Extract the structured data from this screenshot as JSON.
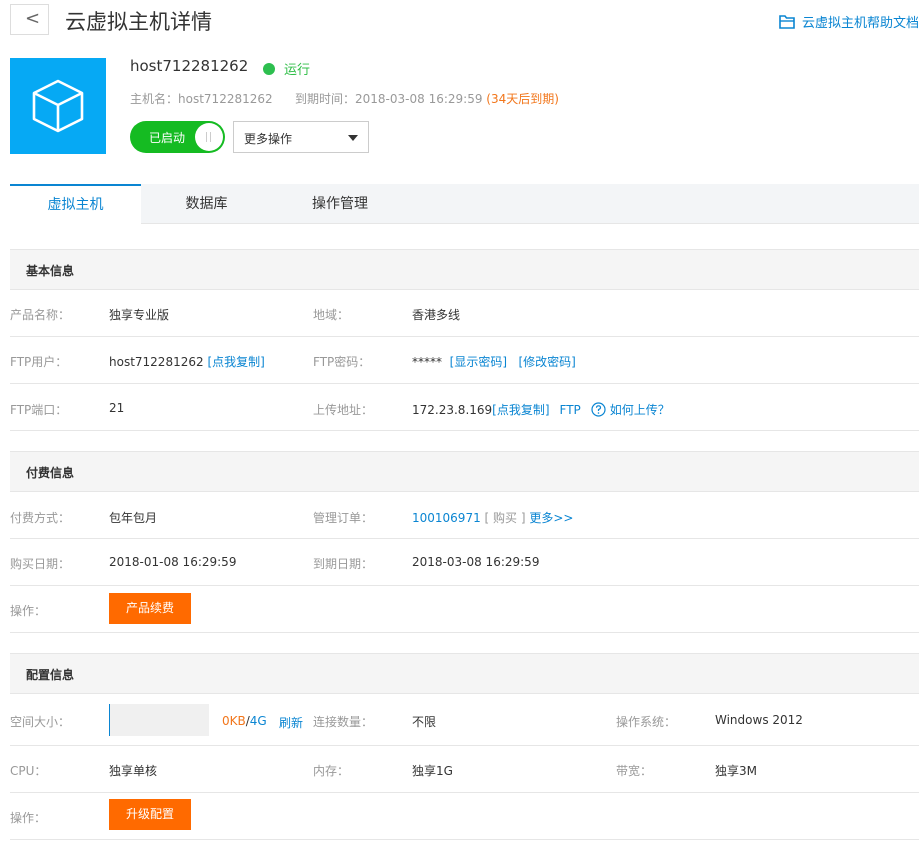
{
  "header": {
    "back_label": "<",
    "title": "云虚拟主机详情",
    "help_label": "云虚拟主机帮助文档"
  },
  "host": {
    "name": "host712281262",
    "status": "运行",
    "hostname_label": "主机名：",
    "hostname": "host712281262",
    "expire_label": "到期时间：",
    "expire_time": "2018-03-08 16:29:59",
    "expire_note": "(34天后到期)",
    "toggle_label": "已启动",
    "more_actions": "更多操作"
  },
  "tabs": [
    {
      "label": "虚拟主机",
      "active": true
    },
    {
      "label": "数据库",
      "active": false
    },
    {
      "label": "操作管理",
      "active": false
    }
  ],
  "basic": {
    "title": "基本信息",
    "product_label": "产品名称：",
    "product_value": "独享专业版",
    "region_label": "地域：",
    "region_value": "香港多线",
    "ftp_user_label": "FTP用户：",
    "ftp_user_value": "host712281262",
    "copy_link": "[点我复制]",
    "ftp_pwd_label": "FTP密码：",
    "ftp_pwd_value": "*****",
    "show_pwd": "[显示密码]",
    "change_pwd": "[修改密码]",
    "ftp_port_label": "FTP端口：",
    "ftp_port_value": "21",
    "upload_label": "上传地址：",
    "upload_value": "172.23.8.169",
    "upload_copy": "[点我复制]",
    "ftp_link": "FTP",
    "how_upload": "如何上传？"
  },
  "billing": {
    "title": "付费信息",
    "pay_label": "付费方式：",
    "pay_value": "包年包月",
    "order_label": "管理订单：",
    "order_id": "100106971",
    "order_type": "[ 购买 ]",
    "more_link": "更多>>",
    "buy_date_label": "购买日期：",
    "buy_date": "2018-01-08 16:29:59",
    "expire_date_label": "到期日期：",
    "expire_date": "2018-03-08 16:29:59",
    "op_label": "操作：",
    "renew_button": "产品续费"
  },
  "config": {
    "title": "配置信息",
    "space_label": "空间大小：",
    "space_used": "0KB",
    "space_sep": "/",
    "space_total": "4G",
    "space_used_fraction": 0,
    "refresh": "刷新",
    "conn_label": "连接数量：",
    "conn_value": "不限",
    "os_label": "操作系统：",
    "os_value": "Windows 2012",
    "cpu_label": "CPU：",
    "cpu_value": "独享单核",
    "mem_label": "内存：",
    "mem_value": "独享1G",
    "bw_label": "带宽：",
    "bw_value": "独享3M",
    "op_label": "操作：",
    "upgrade_button": "升级配置"
  },
  "colors": {
    "accent": "#0a85d2",
    "host_icon_bg": "#06a9f4",
    "running": "#2dbf4f",
    "toggle": "#15bb22",
    "action": "#ff6a00",
    "warn": "#f2761b"
  }
}
